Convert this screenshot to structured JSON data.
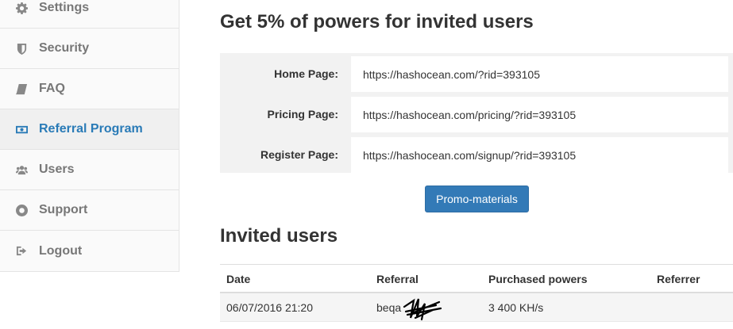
{
  "sidebar": {
    "items": [
      {
        "label": "Settings",
        "icon": "gear-icon",
        "active": false
      },
      {
        "label": "Security",
        "icon": "shield-icon",
        "active": false
      },
      {
        "label": "FAQ",
        "icon": "book-icon",
        "active": false
      },
      {
        "label": "Referral Program",
        "icon": "money-icon",
        "active": true
      },
      {
        "label": "Users",
        "icon": "users-icon",
        "active": false
      },
      {
        "label": "Support",
        "icon": "lifebuoy-icon",
        "active": false
      },
      {
        "label": "Logout",
        "icon": "logout-icon",
        "active": false
      }
    ]
  },
  "main": {
    "title": "Get 5% of powers for invited users",
    "links": [
      {
        "label": "Home Page:",
        "value": "https://hashocean.com/?rid=393105"
      },
      {
        "label": "Pricing Page:",
        "value": "https://hashocean.com/pricing/?rid=393105"
      },
      {
        "label": "Register Page:",
        "value": "https://hashocean.com/signup/?rid=393105"
      }
    ],
    "promo_button": "Promo-materials",
    "invited_title": "Invited users",
    "table": {
      "headers": [
        "Date",
        "Referral",
        "Purchased powers",
        "Referrer"
      ],
      "rows": [
        {
          "date": "06/07/2016 21:20",
          "referral": "beqa",
          "powers": "3 400 KH/s",
          "referrer": ""
        }
      ]
    }
  },
  "colors": {
    "accent": "#2a7bb7",
    "button": "#337ab7",
    "panel": "#f2f2f2"
  }
}
